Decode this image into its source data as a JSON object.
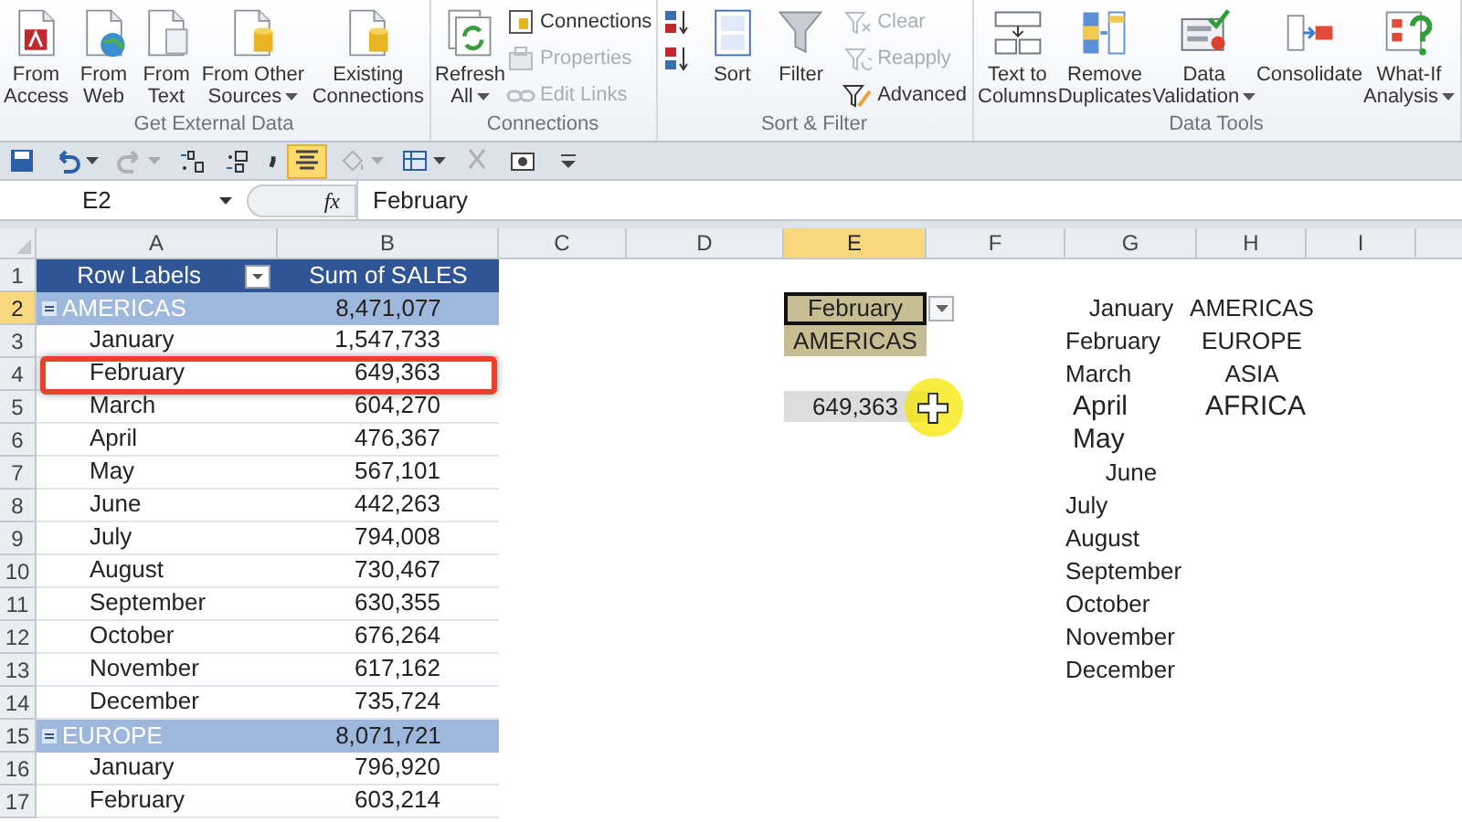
{
  "ribbon": {
    "groups": [
      {
        "label": "Get External Data",
        "items": [
          {
            "kind": "large",
            "lines": [
              "From",
              "Access"
            ],
            "dropdown": false
          },
          {
            "kind": "large",
            "lines": [
              "From",
              "Web"
            ],
            "dropdown": false
          },
          {
            "kind": "large",
            "lines": [
              "From",
              "Text"
            ],
            "dropdown": false
          },
          {
            "kind": "large",
            "lines": [
              "From Other",
              "Sources"
            ],
            "dropdown": true
          },
          {
            "kind": "large",
            "lines": [
              "Existing",
              "Connections"
            ],
            "dropdown": false
          }
        ]
      },
      {
        "label": "Connections",
        "items": [
          {
            "kind": "large",
            "lines": [
              "Refresh",
              "All"
            ],
            "dropdown": true
          },
          {
            "kind": "stack",
            "items": [
              {
                "label": "Connections",
                "disabled": false
              },
              {
                "label": "Properties",
                "disabled": true
              },
              {
                "label": "Edit Links",
                "disabled": true
              }
            ]
          }
        ]
      },
      {
        "label": "Sort & Filter",
        "items": [
          {
            "kind": "stack",
            "items": [
              {
                "disabled": false
              },
              {
                "disabled": false
              }
            ]
          },
          {
            "kind": "large",
            "lines": [
              "Sort"
            ],
            "dropdown": false
          },
          {
            "kind": "large",
            "lines": [
              "Filter"
            ],
            "dropdown": false
          },
          {
            "kind": "stack",
            "items": [
              {
                "label": "Clear",
                "disabled": true
              },
              {
                "label": "Reapply",
                "disabled": true
              },
              {
                "label": "Advanced",
                "disabled": false
              }
            ]
          }
        ]
      },
      {
        "label": "Data Tools",
        "items": [
          {
            "kind": "large",
            "lines": [
              "Text to",
              "Columns"
            ],
            "dropdown": false
          },
          {
            "kind": "large",
            "lines": [
              "Remove",
              "Duplicates"
            ],
            "dropdown": false
          },
          {
            "kind": "large",
            "lines": [
              "Data",
              "Validation"
            ],
            "dropdown": true
          },
          {
            "kind": "large",
            "lines": [
              "Consolidate"
            ],
            "dropdown": false
          },
          {
            "kind": "large",
            "lines": [
              "What-If",
              "Analysis"
            ],
            "dropdown": true
          }
        ]
      }
    ]
  },
  "toolbar": [
    {
      "on": false,
      "disabled": false,
      "dropdown": false
    },
    {
      "on": false,
      "disabled": false,
      "dropdown": true
    },
    {
      "on": false,
      "disabled": true,
      "dropdown": true
    },
    {
      "on": false,
      "disabled": false,
      "dropdown": false
    },
    {
      "on": false,
      "disabled": false,
      "dropdown": false
    },
    {
      "on": false,
      "disabled": false,
      "dropdown": false
    },
    {
      "on": true,
      "disabled": false,
      "dropdown": false
    },
    {
      "on": false,
      "disabled": true,
      "dropdown": true
    },
    {
      "on": false,
      "disabled": false,
      "dropdown": true
    },
    {
      "on": false,
      "disabled": true,
      "dropdown": false
    },
    {
      "on": false,
      "disabled": false,
      "dropdown": false
    },
    {
      "on": false,
      "disabled": false,
      "dropdown": false
    }
  ],
  "formula_bar": {
    "name_box": "E2",
    "fx": "fx",
    "value": "February"
  },
  "columns": [
    {
      "label": "A",
      "selected": false
    },
    {
      "label": "B",
      "selected": false
    },
    {
      "label": "C",
      "selected": false
    },
    {
      "label": "D",
      "selected": false
    },
    {
      "label": "E",
      "selected": true
    },
    {
      "label": "F",
      "selected": false
    },
    {
      "label": "G",
      "selected": false
    },
    {
      "label": "H",
      "selected": false
    },
    {
      "label": "I",
      "selected": false
    }
  ],
  "rows": [
    {
      "label": "1",
      "selected": false
    },
    {
      "label": "2",
      "selected": true
    },
    {
      "label": "3",
      "selected": false
    },
    {
      "label": "4",
      "selected": false
    },
    {
      "label": "5",
      "selected": false
    },
    {
      "label": "6",
      "selected": false
    },
    {
      "label": "7",
      "selected": false
    },
    {
      "label": "8",
      "selected": false
    },
    {
      "label": "9",
      "selected": false
    },
    {
      "label": "10",
      "selected": false
    },
    {
      "label": "11",
      "selected": false
    },
    {
      "label": "12",
      "selected": false
    },
    {
      "label": "13",
      "selected": false
    },
    {
      "label": "14",
      "selected": false
    },
    {
      "label": "15",
      "selected": false
    },
    {
      "label": "16",
      "selected": false
    },
    {
      "label": "17",
      "selected": false
    }
  ],
  "pivot": {
    "header": {
      "label": "Row Labels",
      "value": "Sum of SALES"
    },
    "rows": [
      {
        "kind": "group",
        "label": "AMERICAS",
        "value": "8,471,077",
        "highlighted": false
      },
      {
        "kind": "item",
        "label": "January",
        "value": "1,547,733",
        "highlighted": false
      },
      {
        "kind": "item",
        "label": "February",
        "value": "649,363",
        "highlighted": true
      },
      {
        "kind": "item",
        "label": "March",
        "value": "604,270",
        "highlighted": false
      },
      {
        "kind": "item",
        "label": "April",
        "value": "476,367",
        "highlighted": false
      },
      {
        "kind": "item",
        "label": "May",
        "value": "567,101",
        "highlighted": false
      },
      {
        "kind": "item",
        "label": "June",
        "value": "442,263",
        "highlighted": false
      },
      {
        "kind": "item",
        "label": "July",
        "value": "794,008",
        "highlighted": false
      },
      {
        "kind": "item",
        "label": "August",
        "value": "730,467",
        "highlighted": false
      },
      {
        "kind": "item",
        "label": "September",
        "value": "630,355",
        "highlighted": false
      },
      {
        "kind": "item",
        "label": "October",
        "value": "676,264",
        "highlighted": false
      },
      {
        "kind": "item",
        "label": "November",
        "value": "617,162",
        "highlighted": false
      },
      {
        "kind": "item",
        "label": "December",
        "value": "735,724",
        "highlighted": false
      },
      {
        "kind": "group",
        "label": "EUROPE",
        "value": "8,071,721",
        "highlighted": false
      },
      {
        "kind": "item",
        "label": "January",
        "value": "796,920",
        "highlighted": false
      },
      {
        "kind": "item",
        "label": "February",
        "value": "603,214",
        "highlighted": false
      }
    ]
  },
  "lookup": {
    "month": "February",
    "region": "AMERICAS",
    "result": "649,363"
  },
  "month_list": [
    "January",
    "February",
    "March",
    "April",
    "May",
    "June",
    "July",
    "August",
    "September",
    "October",
    "November",
    "December"
  ],
  "region_list": [
    "AMERICAS",
    "EUROPE",
    "ASIA",
    "AFRICA"
  ]
}
